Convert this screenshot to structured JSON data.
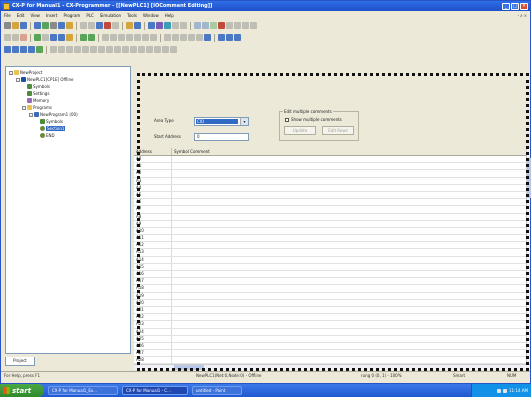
{
  "window": {
    "title": "CX-P for Manual1 - CX-Programmer - [[NewPLC1] [IOComment Editing]]",
    "buttons": {
      "minimize": "_",
      "maximize": "□",
      "close": "×"
    }
  },
  "menu": {
    "items": [
      "File",
      "Edit",
      "View",
      "Insert",
      "Program",
      "PLC",
      "Simulation",
      "Tools",
      "Window",
      "Help"
    ],
    "right": "- ∂ ×"
  },
  "tree": {
    "nodes": [
      {
        "label": "NewProject",
        "icon": "folder",
        "toggle": "-",
        "level": 0
      },
      {
        "label": "NewPLC1[CP1E] Offline",
        "icon": "plc",
        "toggle": "-",
        "level": 1
      },
      {
        "label": "Symbols",
        "icon": "sym",
        "toggle": "",
        "level": 2
      },
      {
        "label": "Settings",
        "icon": "sym",
        "toggle": "",
        "level": 2
      },
      {
        "label": "Memory",
        "icon": "mem",
        "toggle": "",
        "level": 2
      },
      {
        "label": "Programs",
        "icon": "folder",
        "toggle": "-",
        "level": 2
      },
      {
        "label": "NewProgram1 (00)",
        "icon": "prog",
        "toggle": "-",
        "level": 3
      },
      {
        "label": "Symbols",
        "icon": "sym",
        "toggle": "",
        "level": 4
      },
      {
        "label": "Section1",
        "icon": "sec",
        "toggle": "",
        "level": 4,
        "selected": true
      },
      {
        "label": "END",
        "icon": "sec",
        "toggle": "",
        "level": 4
      }
    ],
    "tab": "Project"
  },
  "editor": {
    "area_type_label": "Area Type",
    "area_type_value": "CIO",
    "start_address_label": "Start Address",
    "start_address_value": "0",
    "edit_group_label": "Edit multiple comments",
    "show_multiple_label": "Show multiple comments",
    "update_button": "Update",
    "edit_button": "Edit Rows",
    "columns": [
      "Address",
      "Symbol Comment"
    ],
    "addresses": [
      "A0",
      "A1",
      "A2",
      "A3",
      "A4",
      "A5",
      "A6",
      "A7",
      "A8",
      "A9",
      "A10",
      "A11",
      "A12",
      "A13",
      "A14",
      "A15",
      "A16",
      "A17",
      "A18",
      "A19",
      "A20",
      "A21",
      "A22",
      "A23",
      "A24",
      "A25",
      "A26",
      "A27",
      "A28",
      "A29",
      "A30"
    ]
  },
  "status": {
    "help": "For Help, press F1",
    "plc": "NewPLC1(Net:0,Node:0) - Offline",
    "rung": "rung 0 (0, 1) - 100%",
    "mode": "Smart",
    "num": "NUM"
  },
  "taskbar": {
    "start": "start",
    "tasks": [
      "CX-P for Manual1_Ex...",
      "CX-P for Manual1 - C...",
      "untitled - Paint"
    ],
    "tray_time": "11:14 AM"
  },
  "colors": {
    "title_bar": "#2f6fe8",
    "selection": "#316ac5",
    "taskbar": "#1f57d0"
  }
}
